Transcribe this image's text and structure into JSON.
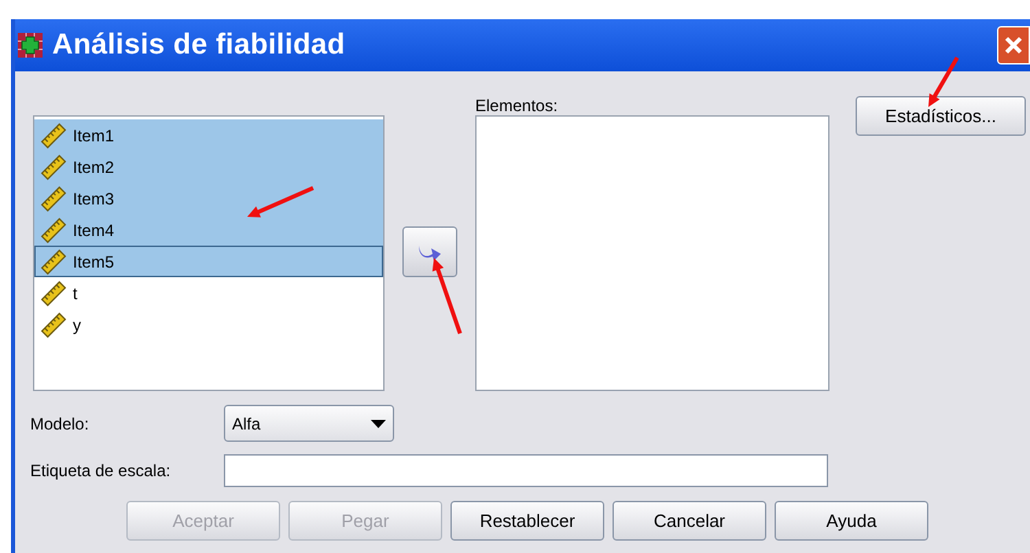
{
  "window": {
    "title": "Análisis de fiabilidad"
  },
  "variables": [
    {
      "label": "Item1",
      "selected": true,
      "focused": false
    },
    {
      "label": "Item2",
      "selected": true,
      "focused": false
    },
    {
      "label": "Item3",
      "selected": true,
      "focused": false
    },
    {
      "label": "Item4",
      "selected": true,
      "focused": false
    },
    {
      "label": "Item5",
      "selected": true,
      "focused": true
    },
    {
      "label": "t",
      "selected": false,
      "focused": false
    },
    {
      "label": "y",
      "selected": false,
      "focused": false
    }
  ],
  "elements": {
    "label": "Elementos:"
  },
  "statistics_button": "Estadísticos...",
  "model": {
    "label": "Modelo:",
    "value": "Alfa"
  },
  "scale_label": {
    "label": "Etiqueta de escala:"
  },
  "buttons": [
    {
      "label": "Aceptar",
      "disabled": true
    },
    {
      "label": "Pegar",
      "disabled": true
    },
    {
      "label": "Restablecer",
      "disabled": false
    },
    {
      "label": "Cancelar",
      "disabled": false
    },
    {
      "label": "Ayuda",
      "disabled": false
    }
  ]
}
